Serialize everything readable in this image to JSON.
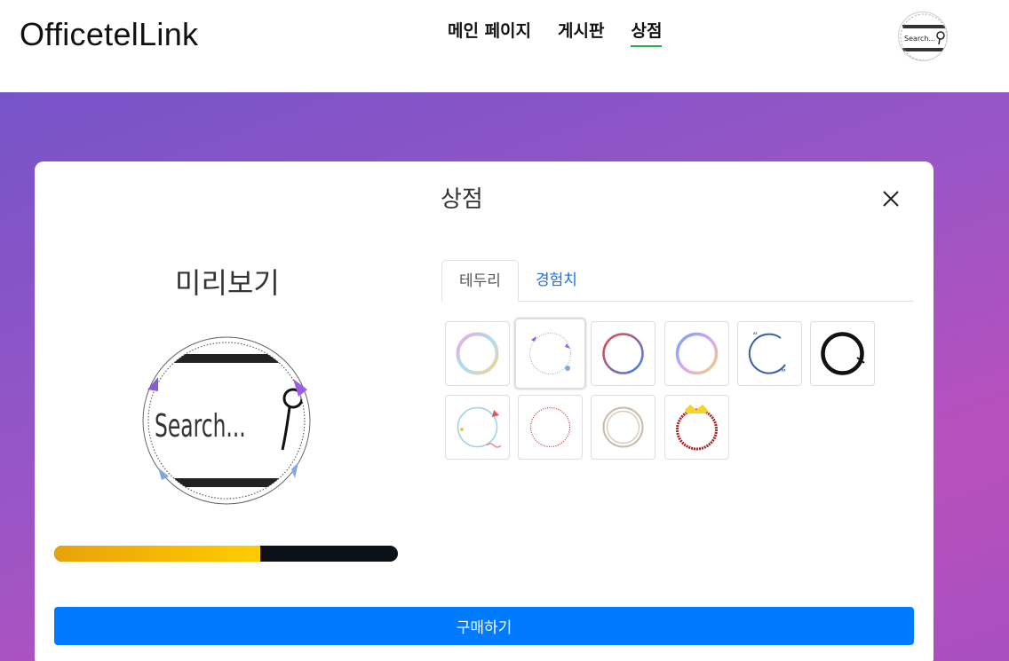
{
  "navbar": {
    "brand": "OfficetelLink",
    "links": [
      {
        "label": "메인 페이지",
        "active": false
      },
      {
        "label": "게시판",
        "active": false
      },
      {
        "label": "상점",
        "active": true
      }
    ],
    "avatar_text": "Search..."
  },
  "modal": {
    "title": "상점",
    "preview_title": "미리보기",
    "preview_avatar_text": "Search...",
    "progress_fraction": 0.6,
    "tabs": [
      {
        "label": "테두리",
        "active": true
      },
      {
        "label": "경험치",
        "active": false
      }
    ],
    "frames": [
      {
        "name": "pastel-gradient-ring",
        "selected": false
      },
      {
        "name": "arrow-triangle-ring",
        "selected": true
      },
      {
        "name": "red-blue-ring",
        "selected": false
      },
      {
        "name": "blue-yellow-ring",
        "selected": false
      },
      {
        "name": "quote-ring",
        "selected": false
      },
      {
        "name": "ink-brush-ring",
        "selected": false
      },
      {
        "name": "cute-arrow-ring",
        "selected": false
      },
      {
        "name": "dotted-red-ring",
        "selected": false
      },
      {
        "name": "double-beige-ring",
        "selected": false
      },
      {
        "name": "crown-red-ring",
        "selected": false
      }
    ],
    "buy_label": "구매하기"
  },
  "colors": {
    "accent": "#007bff",
    "active_underline": "#22b14c",
    "progress_start": "#e8a20a",
    "progress_end": "#ffcc00",
    "progress_track": "#0d1117",
    "background_gradient_start": "#7654c8",
    "background_gradient_end": "#b850bd"
  }
}
